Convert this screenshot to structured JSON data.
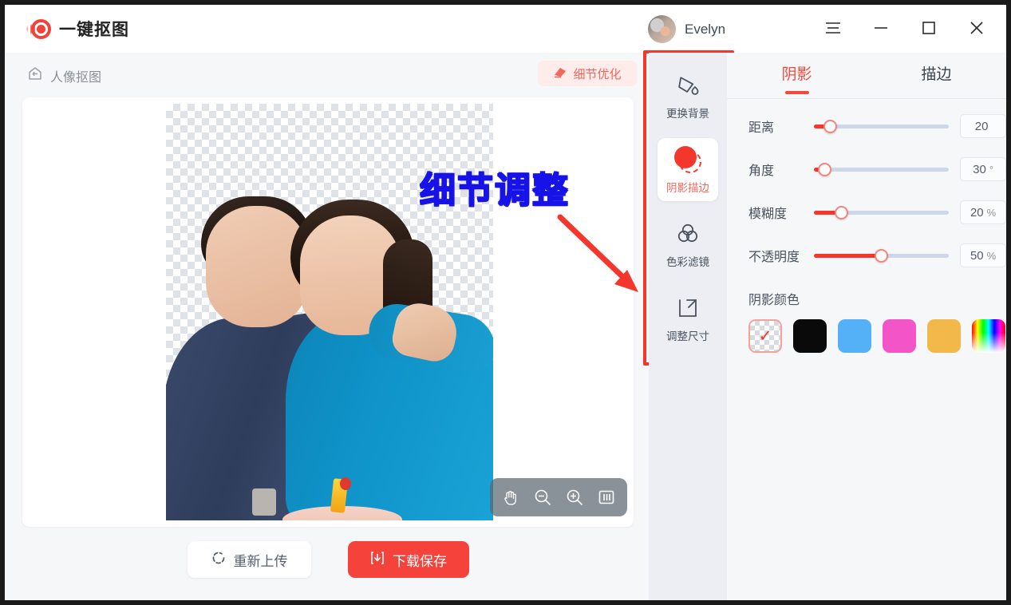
{
  "app": {
    "title": "一键抠图",
    "logo_color": "#f04438"
  },
  "titlebar": {
    "user_name": "Evelyn",
    "menu_icon": "hamburger-menu-icon",
    "minimize_icon": "minimize-icon",
    "maximize_icon": "maximize-icon",
    "close_icon": "close-icon"
  },
  "breadcrumb": {
    "label": "人像抠图",
    "icon": "home-back-icon"
  },
  "refine": {
    "label": "细节优化",
    "icon": "eraser-icon",
    "color": "#f3665c"
  },
  "annotation": {
    "text": "细节调整",
    "text_color": "#1713e8",
    "highlight_color": "#f5362c"
  },
  "canvas": {
    "zoom_tools": [
      {
        "name": "pan-hand-icon",
        "label": "抓手"
      },
      {
        "name": "zoom-out-icon",
        "label": "缩小"
      },
      {
        "name": "zoom-in-icon",
        "label": "放大"
      },
      {
        "name": "fit-screen-icon",
        "label": "适应屏幕"
      }
    ]
  },
  "tools": [
    {
      "label": "更换背景",
      "icon": "paint-bucket-icon",
      "active": false
    },
    {
      "label": "阴影描边",
      "icon": "shadow-stroke-icon",
      "active": true
    },
    {
      "label": "色彩滤镜",
      "icon": "color-filter-icon",
      "active": false
    },
    {
      "label": "调整尺寸",
      "icon": "resize-icon",
      "active": false
    }
  ],
  "panel": {
    "tabs": [
      {
        "label": "阴影",
        "active": true
      },
      {
        "label": "描边",
        "active": false
      }
    ],
    "accent_color": "#f5483d",
    "sliders": [
      {
        "label": "距离",
        "value": "20",
        "unit": "",
        "percent": 12
      },
      {
        "label": "角度",
        "value": "30",
        "unit": "°",
        "percent": 8
      },
      {
        "label": "模糊度",
        "value": "20",
        "unit": "%",
        "percent": 20
      },
      {
        "label": "不透明度",
        "value": "50",
        "unit": "%",
        "percent": 50
      }
    ],
    "color_section_title": "阴影颜色",
    "colors": [
      {
        "name": "transparent",
        "hex": "transparent",
        "selected": true
      },
      {
        "name": "black",
        "hex": "#0a0a0a",
        "selected": false
      },
      {
        "name": "blue",
        "hex": "#54b0f7",
        "selected": false
      },
      {
        "name": "pink",
        "hex": "#f354c8",
        "selected": false
      },
      {
        "name": "orange",
        "hex": "#f3b84a",
        "selected": false
      },
      {
        "name": "rainbow",
        "hex": "rainbow",
        "selected": false
      }
    ]
  },
  "actions": {
    "reupload_label": "重新上传",
    "reupload_icon": "refresh-icon",
    "download_label": "下载保存",
    "download_icon": "download-icon"
  }
}
